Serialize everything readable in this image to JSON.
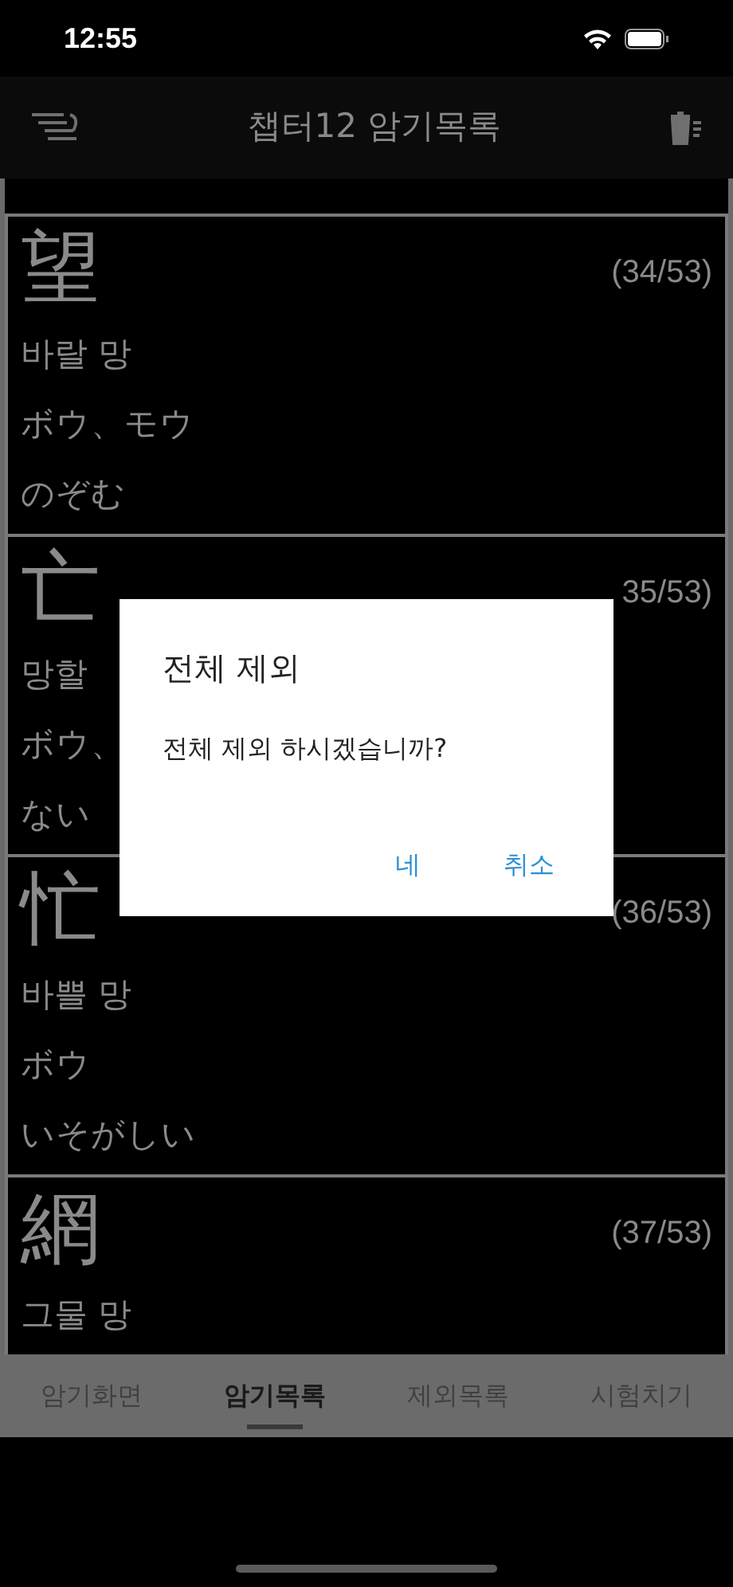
{
  "status_bar": {
    "time": "12:55"
  },
  "app_bar": {
    "title": "챕터12 암기목록"
  },
  "cards": [
    {
      "kanji": "望",
      "count": "(34/53)",
      "lines": [
        "바랄 망",
        "ボウ、モウ",
        "のぞむ"
      ]
    },
    {
      "kanji": "亡",
      "count": "35/53)",
      "lines": [
        "망할",
        "ボウ、",
        "ない"
      ]
    },
    {
      "kanji": "忙",
      "count": "(36/53)",
      "lines": [
        "바쁠 망",
        "ボウ",
        "いそがしい"
      ]
    },
    {
      "kanji": "網",
      "count": "(37/53)",
      "lines": [
        "그물 망"
      ]
    }
  ],
  "tabs": [
    {
      "label": "암기화면",
      "selected": false
    },
    {
      "label": "암기목록",
      "selected": true
    },
    {
      "label": "제외목록",
      "selected": false
    },
    {
      "label": "시험치기",
      "selected": false
    }
  ],
  "dialog": {
    "title": "전체 제외",
    "message": "전체 제외 하시겠습니까?",
    "buttons": [
      "네",
      "취소"
    ]
  }
}
